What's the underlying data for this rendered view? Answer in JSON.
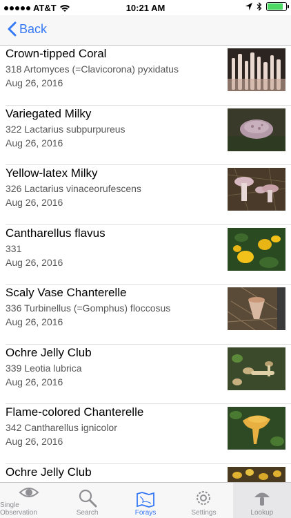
{
  "status_bar": {
    "carrier": "AT&T",
    "time": "10:21 AM"
  },
  "nav": {
    "back_label": "Back"
  },
  "observations": [
    {
      "name": "Crown-tipped Coral",
      "detail": "318 Artomyces (=Clavicorona) pyxidatus",
      "date": "Aug 26, 2016"
    },
    {
      "name": "Variegated Milky",
      "detail": "322 Lactarius subpurpureus",
      "date": "Aug 26, 2016"
    },
    {
      "name": "Yellow-latex Milky",
      "detail": "326 Lactarius vinaceorufescens",
      "date": "Aug 26, 2016"
    },
    {
      "name": "Cantharellus flavus",
      "detail": "331",
      "date": "Aug 26, 2016"
    },
    {
      "name": "Scaly Vase Chanterelle",
      "detail": "336 Turbinellus (=Gomphus) floccosus",
      "date": "Aug 26, 2016"
    },
    {
      "name": "Ochre Jelly Club",
      "detail": "339 Leotia lubrica",
      "date": "Aug 26, 2016"
    },
    {
      "name": "Flame-colored Chanterelle",
      "detail": "342 Cantharellus ignicolor",
      "date": "Aug 26, 2016"
    },
    {
      "name": "Ochre Jelly Club",
      "detail": "",
      "date": ""
    }
  ],
  "tabs": [
    {
      "label": "Single Observation"
    },
    {
      "label": "Search"
    },
    {
      "label": "Forays"
    },
    {
      "label": "Settings"
    },
    {
      "label": "Lookup"
    }
  ],
  "colors": {
    "accent": "#3478f6",
    "inactive": "#8e8e93"
  }
}
